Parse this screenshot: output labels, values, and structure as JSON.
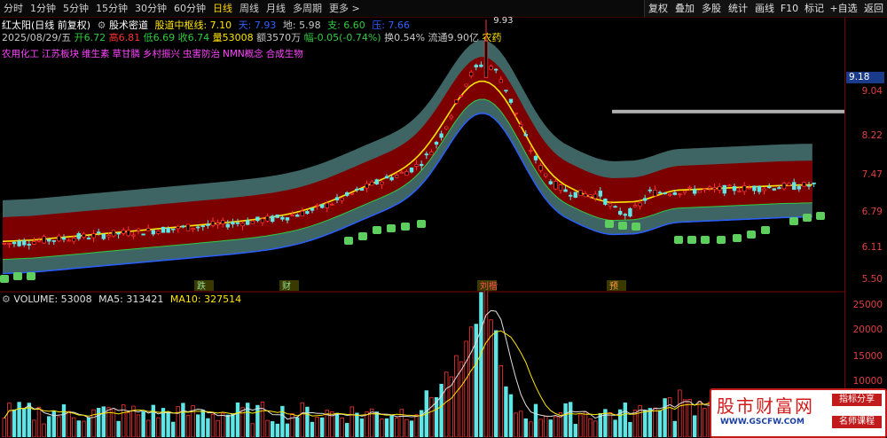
{
  "toolbar": {
    "timeframes": [
      "分时",
      "1分钟",
      "5分钟",
      "15分钟",
      "30分钟",
      "60分钟",
      "日线",
      "周线",
      "月线",
      "多周期",
      "更多 >"
    ],
    "active": "日线",
    "right_buttons": [
      "复权",
      "叠加",
      "多股",
      "统计",
      "画线",
      "F10",
      "标记",
      "+自选",
      "返回"
    ]
  },
  "info_line1": {
    "stock": "红太阳(日线 前复权)",
    "indicator": "股术密道",
    "zhongshu_label": "股道中枢线: 7.10",
    "tian": "天: 7.93",
    "di": "地: 5.98",
    "zhi": "支: 6.60",
    "ya": "压: 7.66"
  },
  "info_line2": {
    "date": "2025/08/29/五",
    "open": "开6.72",
    "high": "高6.81",
    "low": "低6.69",
    "close": "收6.74",
    "volume": "量53008",
    "amount": "额3570万",
    "change": "幅-0.05(-0.74%)",
    "turnover": "换0.54%",
    "float_cap": "流通9.90亿",
    "sector": "农药"
  },
  "concepts": [
    "农用化工",
    "江苏板块",
    "维生素",
    "草甘膦",
    "乡村振兴",
    "虫害防治",
    "NMN概念",
    "合成生物"
  ],
  "price_axis": [
    "9.04",
    "8.22",
    "7.47",
    "6.79",
    "6.11",
    "5.50"
  ],
  "current_price": "9.18",
  "peak_label": "9.93",
  "event_markers": [
    "跌",
    "财",
    "刘楷",
    "预"
  ],
  "volume_header": {
    "volume": "VOLUME: 53008",
    "ma5": "MA5: 313421",
    "ma10": "MA10: 327514"
  },
  "volume_axis": [
    "25000",
    "20000",
    "15000",
    "10000"
  ],
  "logo": {
    "title": "股市财富网",
    "url": "WWW.GSCFW.COM",
    "tag1": "指标分享",
    "tag2": "名师课程"
  },
  "colors": {
    "up": "#ff3333",
    "down": "#5ee6e6",
    "band_outer": "#3f6464",
    "band_inner": "#7d0000",
    "zhongshu_line": "#ffe600",
    "support_line": "#2ecc40",
    "concept": "#ff44ff"
  }
}
